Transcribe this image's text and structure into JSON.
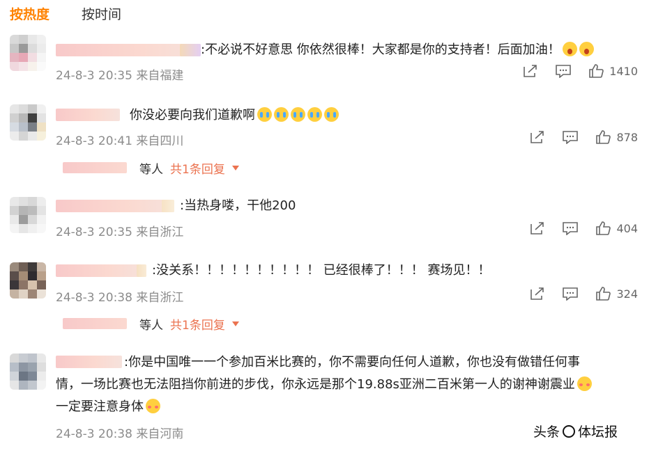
{
  "tabs": [
    {
      "label": "按热度",
      "active": true
    },
    {
      "label": "按时间",
      "active": false
    }
  ],
  "comments": [
    {
      "text": ":不必说不好意思 你依然很棒！大家都是你的支持者！后面加油！",
      "emojis": [
        "shock-icon",
        "shock-icon"
      ],
      "time": "24-8-3 20:35",
      "location": "来自福建",
      "likes": "1410"
    },
    {
      "text": "你没必要向我们道歉啊",
      "emojis": [
        "crying-icon",
        "crying-icon",
        "crying-icon",
        "crying-icon",
        "crying-icon"
      ],
      "time": "24-8-3 20:41",
      "location": "来自四川",
      "likes": "878",
      "reply": {
        "who": "等人",
        "count": "共1条回复"
      }
    },
    {
      "text": ":当热身喽，干他200",
      "time": "24-8-3 20:35",
      "location": "来自浙江",
      "likes": "404"
    },
    {
      "text": ":没关系！！！！！！！！！！ 已经很棒了！！！ 赛场见！！",
      "time": "24-8-3 20:38",
      "location": "来自浙江",
      "likes": "324",
      "reply": {
        "who": "等人",
        "count": "共1条回复"
      }
    },
    {
      "text_line1": ":你是中国唯一一个参加百米比赛的，你不需要向任何人道歉，你也没有做错任何事",
      "text_line2": "情，一场比赛也无法阻挡你前进的步伐，你永远是那个19.88s亚洲二百米第一人的谢神谢震业",
      "text_line3": "一定要注意身体",
      "emojis": [
        "blush-icon",
        "blush-icon"
      ],
      "time": "24-8-3 20:38",
      "location": "来自河南"
    }
  ],
  "watermark": {
    "text_left": "头条",
    "text_right": "体坛报"
  }
}
